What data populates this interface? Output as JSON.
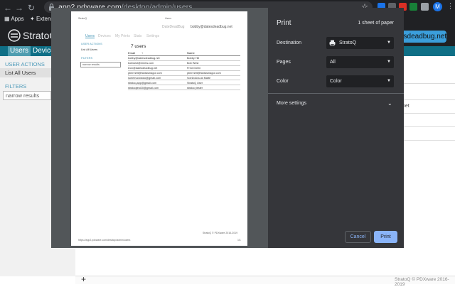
{
  "browser": {
    "url_host": "app2.pdxware.com",
    "url_path": "/desktop/admin/users",
    "bookmarks": [
      "Apps",
      "Extens"
    ]
  },
  "app": {
    "logo": "StratoQ",
    "user_pill": "esdeadbug.net",
    "tabs": [
      "Users",
      "Devices"
    ],
    "sidebar": {
      "user_actions": "USER ACTIONS",
      "list_all": "List All Users",
      "filters": "FILTERS",
      "filter_placeholder": "narrow results"
    },
    "row_fragment": "net",
    "footer": "StratoQ © PDXware 2016-2019"
  },
  "print_preview": {
    "header_left": "StratoQ",
    "header_center": "Users",
    "brand_faded": "DateDeadBug",
    "brand_email": "bobby@datesdeadbug.net",
    "tabs": [
      "Users",
      "Devices",
      "My Prints",
      "Stats",
      "Settings"
    ],
    "side_user_actions": "USER ACTIONS",
    "side_list_all": "List All Users",
    "side_filters": "FILTERS",
    "side_filter_placeholder": "narrow results",
    "count_title": "7 users",
    "columns": [
      "Email",
      "Name"
    ],
    "rows": [
      [
        "bobby@datesdeadbug.net",
        "Bobby Hill"
      ],
      [
        "bobwest@imrew.com",
        "Bob West"
      ],
      [
        "Don@datesdeadbug.net",
        "Fred Green"
      ],
      [
        "pbennett@fantasmagor.com",
        "pbennett@fantasmagor.com"
      ],
      [
        "soeemudotodo@gmail.com",
        "SoeDoDoLok Matte"
      ],
      [
        "stratoq.app@gmail.com",
        "StratoQ User"
      ],
      [
        "stratoqtest20@gmail.com",
        "stratoq tester"
      ]
    ],
    "footer_right": "StratoQ © PDXware 2016-2019",
    "footer_url": "https://app2.pdxware.com/desktop/admin/users",
    "page_number": "1/1"
  },
  "print_settings": {
    "title": "Print",
    "sheets": "1 sheet of paper",
    "destination_label": "Destination",
    "destination_value": "StratoQ",
    "pages_label": "Pages",
    "pages_value": "All",
    "color_label": "Color",
    "color_value": "Color",
    "more_settings": "More settings",
    "cancel": "Cancel",
    "print": "Print"
  }
}
